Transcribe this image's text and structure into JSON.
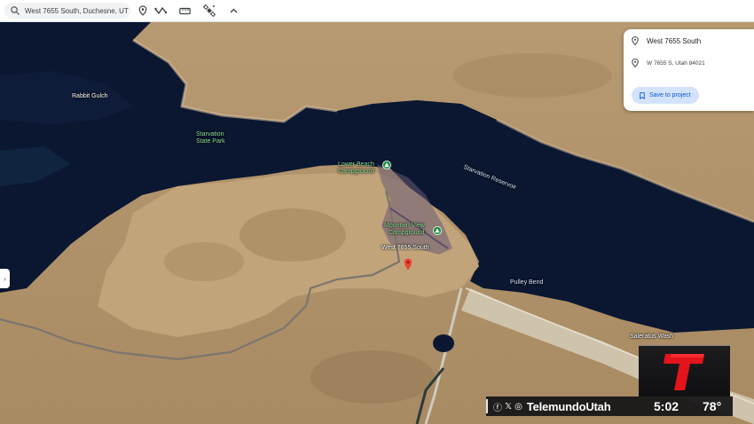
{
  "toolbar": {
    "search_value": "West 7655 South, Duchesne, UT",
    "icons": [
      "search-icon",
      "location-pin-icon",
      "path-icon",
      "ruler-icon",
      "satellite-icon",
      "chevron-up-icon"
    ]
  },
  "map": {
    "labels": {
      "rabbit_gulch": "Rabbit Gulch",
      "starvation_state_park_1": "Starvation",
      "starvation_state_park_2": "State Park",
      "lower_beach_1": "Lower Beach",
      "lower_beach_2": "Campground",
      "starvation_reservoir": "Starvation Reservoir",
      "mountain_view_1": "Mountain View",
      "mountain_view_2": "Campground",
      "west_7655_south": "West 7655 South",
      "pulley_bend": "Pulley Bend",
      "saleratus_wash": "Saleratus Wash"
    }
  },
  "panel": {
    "title": "West 7655 South",
    "address": "W 7655 S, Utah 84021",
    "save_label": "Save to project"
  },
  "broadcast": {
    "handle": "TelemundoUtah",
    "time": "5:02",
    "temperature": "78°",
    "social_icons": [
      "facebook-icon",
      "x-icon",
      "instagram-icon"
    ],
    "logo_color": "#e4141b"
  }
}
